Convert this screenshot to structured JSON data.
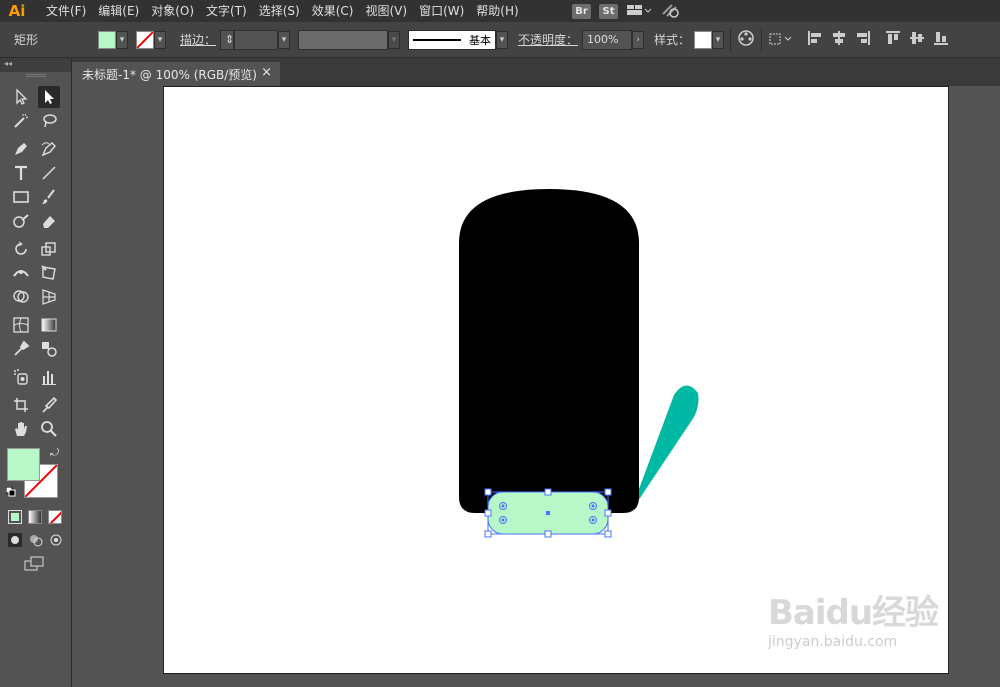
{
  "app": {
    "logo": "Ai"
  },
  "menu": [
    "文件(F)",
    "编辑(E)",
    "对象(O)",
    "文字(T)",
    "选择(S)",
    "效果(C)",
    "视图(V)",
    "窗口(W)",
    "帮助(H)"
  ],
  "bridge_badges": {
    "br": "Br",
    "st": "St"
  },
  "control": {
    "object_label": "矩形",
    "fill_color": "#b7f7c8",
    "stroke_label": "描边：",
    "stroke_profile": "基本",
    "opacity_label": "不透明度：",
    "opacity_value": "100%",
    "style_label": "样式："
  },
  "document": {
    "tab_title": "未标题-1* @ 100% (RGB/预览)",
    "close_symbol": "×"
  },
  "colors": {
    "fill": "#b7f7c8",
    "teal": "#00b8a3",
    "black": "#000000",
    "selection": "#4a72ff"
  },
  "tools": [
    "selection-tool",
    "direct-selection-tool",
    "magic-wand-tool",
    "lasso-tool",
    "pen-tool",
    "curvature-tool",
    "type-tool",
    "line-tool",
    "rectangle-tool",
    "paintbrush-tool",
    "shaper-tool",
    "eraser-tool",
    "rotate-tool",
    "scale-tool",
    "width-tool",
    "free-transform-tool",
    "shape-builder-tool",
    "perspective-grid-tool",
    "mesh-tool",
    "gradient-tool",
    "eyedropper-tool",
    "blend-tool",
    "symbol-sprayer-tool",
    "column-graph-tool",
    "artboard-tool",
    "slice-tool",
    "hand-tool",
    "zoom-tool"
  ],
  "watermark": {
    "brand": "Baidu经验",
    "url": "jingyan.baidu.com"
  }
}
